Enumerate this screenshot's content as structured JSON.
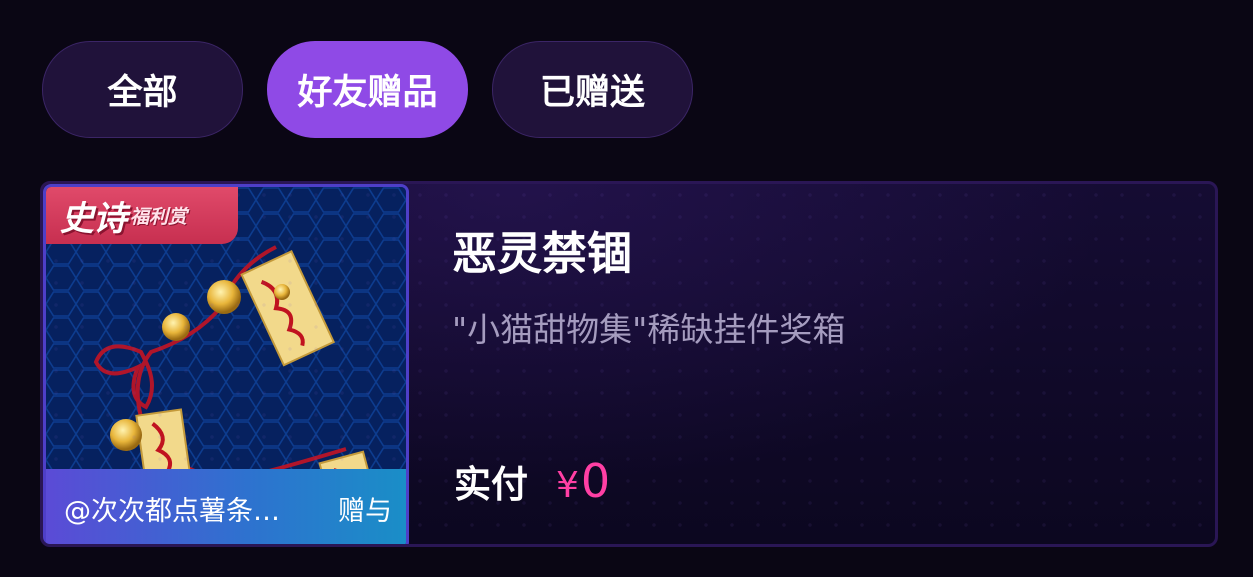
{
  "tabs": [
    {
      "label": "全部",
      "active": false
    },
    {
      "label": "好友赠品",
      "active": true
    },
    {
      "label": "已赠送",
      "active": false
    }
  ],
  "card": {
    "badge": {
      "main": "史诗",
      "sub": "福利赏"
    },
    "title": "恶灵禁锢",
    "subtitle": "\"小猫甜物集\"稀缺挂件奖箱",
    "gift": {
      "from": "@次次都点薯条…",
      "action": "赠与"
    },
    "price": {
      "label": "实付",
      "currency": "¥",
      "value": "0"
    },
    "item_image": "charm-with-talismans-and-bells"
  },
  "colors": {
    "background": "#0a0614",
    "tab_active": "#8f4ae6",
    "tab_inactive": "#20123a",
    "price": "#ff3fa4",
    "badge": "#d83c5e"
  }
}
